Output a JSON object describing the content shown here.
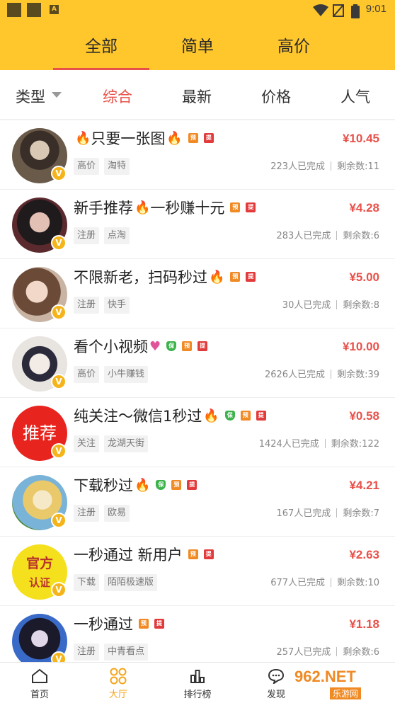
{
  "status_bar": {
    "time": "9:01"
  },
  "category_tabs": [
    {
      "label": "全部",
      "active": true
    },
    {
      "label": "简单",
      "active": false
    },
    {
      "label": "高价",
      "active": false
    }
  ],
  "filter_bar": {
    "type_label": "类型",
    "sorts": [
      {
        "label": "综合",
        "active": true
      },
      {
        "label": "最新",
        "active": false
      },
      {
        "label": "价格",
        "active": false
      },
      {
        "label": "人气",
        "active": false
      }
    ]
  },
  "tasks": [
    {
      "title": "只要一张图",
      "tags": [
        "高价",
        "淘特"
      ],
      "price": "¥10.45",
      "completed": "223人已完成",
      "remaining": "剩余数:11"
    },
    {
      "title": "新手推荐",
      "title2": "一秒赚十元",
      "tags": [
        "注册",
        "点淘"
      ],
      "price": "¥4.28",
      "completed": "283人已完成",
      "remaining": "剩余数:6"
    },
    {
      "title": "不限新老，扫码秒过",
      "tags": [
        "注册",
        "快手"
      ],
      "price": "¥5.00",
      "completed": "30人已完成",
      "remaining": "剩余数:8"
    },
    {
      "title": "看个小视频",
      "tags": [
        "高价",
        "小牛赚钱"
      ],
      "price": "¥10.00",
      "completed": "2626人已完成",
      "remaining": "剩余数:39"
    },
    {
      "title": "纯关注～微信1秒过",
      "avatar_text": "推荐",
      "tags": [
        "关注",
        "龙湖天街"
      ],
      "price": "¥0.58",
      "completed": "1424人已完成",
      "remaining": "剩余数:122"
    },
    {
      "title": "下载秒过",
      "tags": [
        "注册",
        "欧易"
      ],
      "price": "¥4.21",
      "completed": "167人已完成",
      "remaining": "剩余数:7"
    },
    {
      "title": "一秒通过 新用户",
      "avatar_text": "官方",
      "avatar_text2": "认证",
      "tags": [
        "下载",
        "陌陌极速版"
      ],
      "price": "¥2.63",
      "completed": "677人已完成",
      "remaining": "剩余数:10"
    },
    {
      "title": "一秒通过",
      "tags": [
        "注册",
        "中青看点"
      ],
      "price": "¥1.18",
      "completed": "257人已完成",
      "remaining": "剩余数:6"
    }
  ],
  "badges": {
    "pre": "预",
    "withdraw": "提",
    "guarantee": "保"
  },
  "tab_bar": [
    {
      "label": "首页",
      "icon": "home-icon",
      "active": false
    },
    {
      "label": "大厅",
      "icon": "hall-icon",
      "active": true
    },
    {
      "label": "排行榜",
      "icon": "ranking-icon",
      "active": false
    },
    {
      "label": "发现",
      "icon": "discover-icon",
      "active": false
    }
  ],
  "watermark": {
    "brand": "962.NET",
    "sub": "乐游网"
  },
  "colors": {
    "header": "#ffc72c",
    "accent": "#e8514a",
    "active_tab": "#f4a51a"
  }
}
